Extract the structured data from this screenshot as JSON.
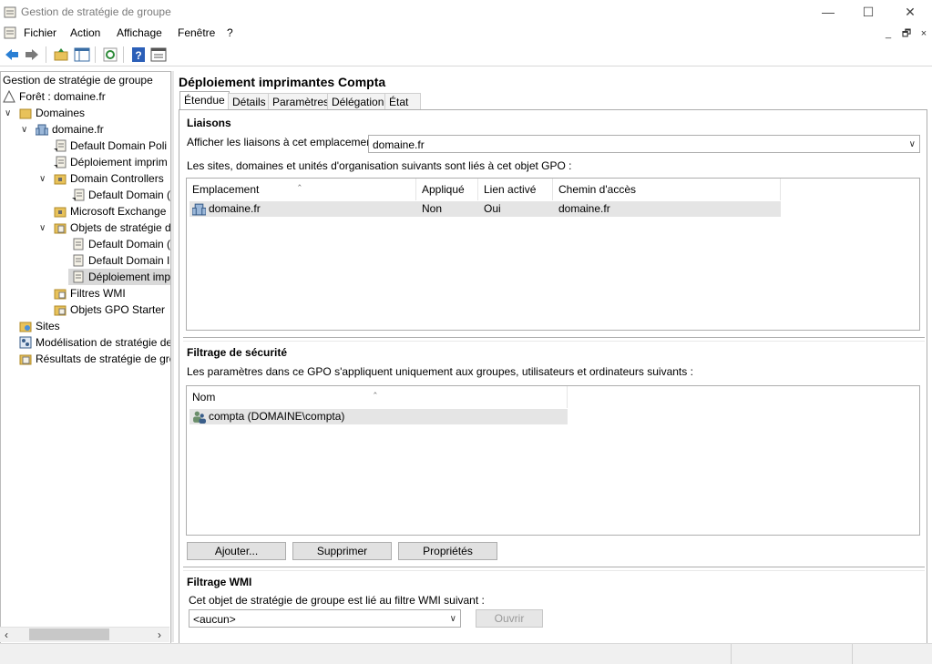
{
  "window": {
    "title": "Gestion de stratégie de groupe",
    "min": "—",
    "max": "☐",
    "close": "✕"
  },
  "menu": {
    "items": [
      "Fichier",
      "Action",
      "Affichage",
      "Fenêtre",
      "?"
    ],
    "mdi_min": "_",
    "mdi_restore": "🗗",
    "mdi_close": "×"
  },
  "tree": {
    "root": "Gestion de stratégie de groupe",
    "forest": "Forêt : domaine.fr",
    "domains": "Domaines",
    "domain": "domaine.fr",
    "default_domain_policy": "Default Domain Poli",
    "deploiement_link": "Déploiement imprim",
    "domain_controllers": "Domain Controllers",
    "dc_default": "Default Domain (",
    "exchange": "Microsoft Exchange",
    "gpo_objects": "Objets de stratégie d",
    "gpo_default1": "Default Domain (",
    "gpo_default2": "Default Domain I",
    "gpo_deploiement": "Déploiement imp",
    "wmi_filters": "Filtres WMI",
    "starter_gpo": "Objets GPO Starter",
    "sites": "Sites",
    "modeling": "Modélisation de stratégie de",
    "results": "Résultats de stratégie de gro"
  },
  "details": {
    "title": "Déploiement imprimantes Compta",
    "tabs": [
      "Étendue",
      "Détails",
      "Paramètres",
      "Délégation",
      "État"
    ],
    "links": {
      "heading": "Liaisons",
      "show_label": "Afficher les liaisons à cet emplacement :",
      "show_value": "domaine.fr",
      "desc": "Les sites, domaines et unités d'organisation suivants sont liés à cet objet GPO :",
      "columns": [
        "Emplacement",
        "Appliqué",
        "Lien activé",
        "Chemin d'accès"
      ],
      "rows": [
        {
          "location": "domaine.fr",
          "applied": "Non",
          "enabled": "Oui",
          "path": "domaine.fr"
        }
      ]
    },
    "security": {
      "heading": "Filtrage de sécurité",
      "desc": "Les paramètres dans ce GPO s'appliquent uniquement aux groupes, utilisateurs et ordinateurs suivants :",
      "column": "Nom",
      "rows": [
        "compta (DOMAINE\\compta)"
      ],
      "buttons": {
        "add": "Ajouter...",
        "remove": "Supprimer",
        "properties": "Propriétés"
      }
    },
    "wmi": {
      "heading": "Filtrage WMI",
      "desc": "Cet objet de stratégie de groupe est lié au filtre WMI suivant :",
      "value": "<aucun>",
      "open": "Ouvrir"
    }
  },
  "colors": {
    "folder": "#e8c25a",
    "gpo_doc": "#f4f1e6",
    "back_arrow": "#2a7fd4",
    "help": "#2b5fb8"
  }
}
